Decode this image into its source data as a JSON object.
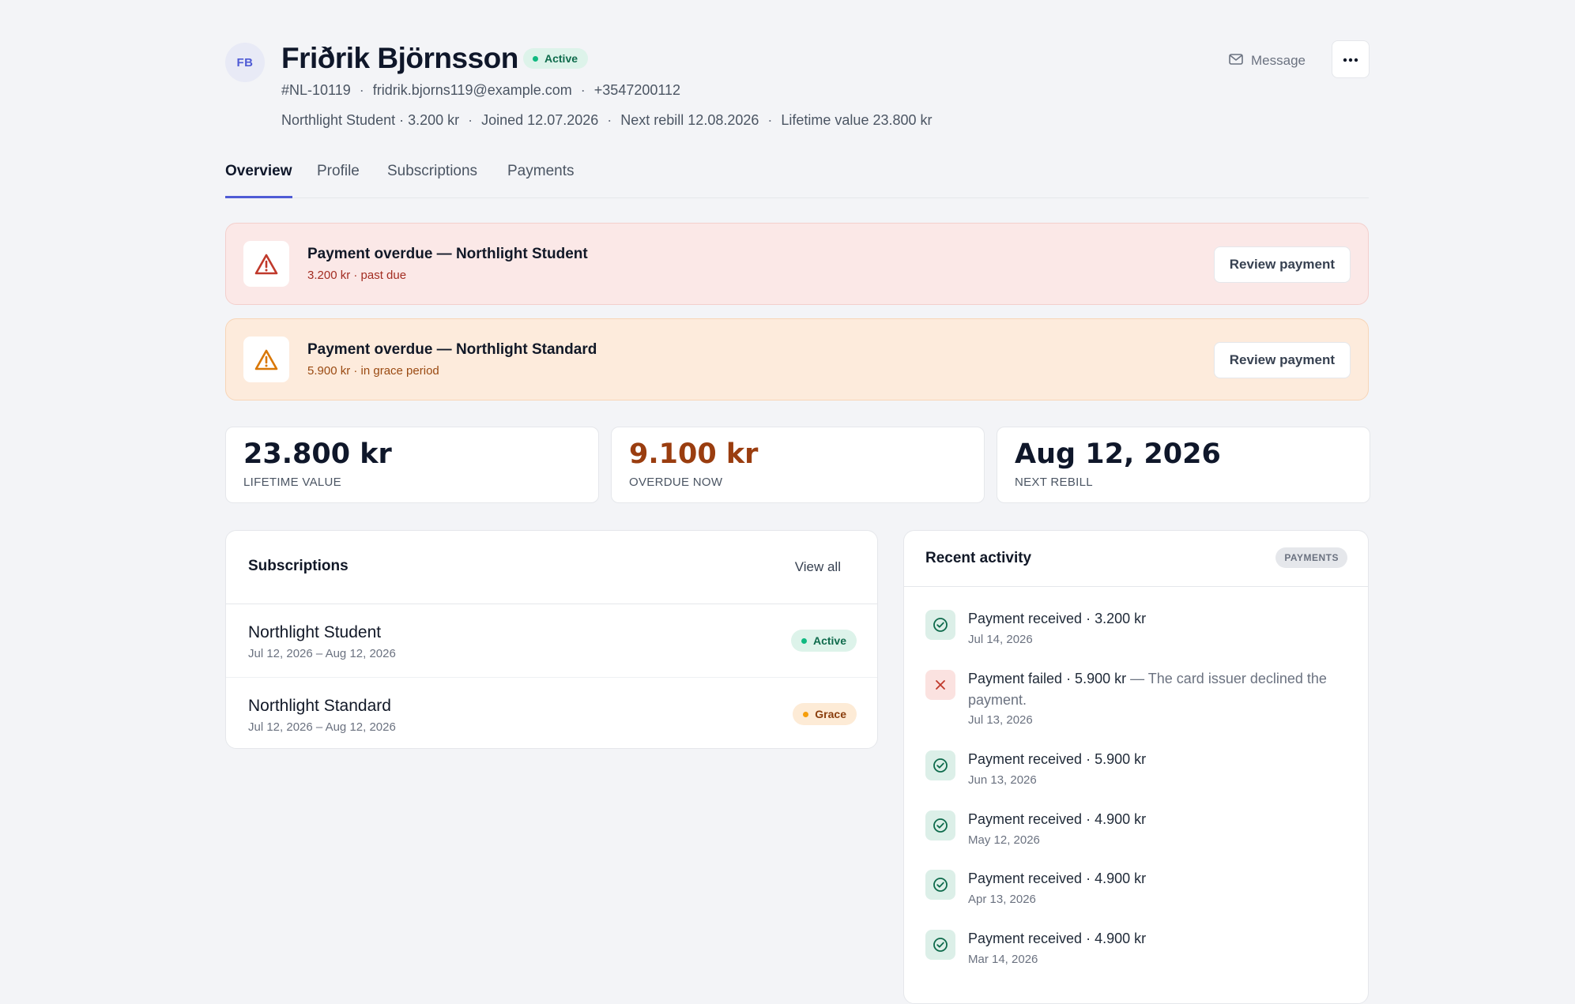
{
  "customer": {
    "initials": "FB",
    "name": "Friðrik Björnsson",
    "status": "Active",
    "id": "#NL-10119",
    "email": "fridrik.bjorns119@example.com",
    "phone": "+3547200112",
    "plan": "Northlight Student · 3.200 kr",
    "joined": "Joined 12.07.2026",
    "next_rebill": "Next rebill 12.08.2026",
    "lifetime_value": "Lifetime value 23.800 kr",
    "separator": "·"
  },
  "actions": {
    "message_label": "Message",
    "more_icon": "more-horizontal-icon"
  },
  "tabs": [
    {
      "label": "Overview",
      "active": true
    },
    {
      "label": "Profile"
    },
    {
      "label": "Subscriptions"
    },
    {
      "label": "Payments"
    }
  ],
  "alerts": [
    {
      "title": "Payment overdue — Northlight Student",
      "subtitle": "3.200 kr · past due",
      "button": "Review payment",
      "color": "#c0392b",
      "icon": "warning-triangle-icon"
    },
    {
      "title": "Payment overdue — Northlight Standard",
      "subtitle": "5.900 kr · in grace period",
      "button": "Review payment",
      "color": "#d97706",
      "icon": "warning-triangle-icon"
    }
  ],
  "stats": [
    {
      "value": "23.800 kr",
      "label": "LIFETIME VALUE"
    },
    {
      "value": "9.100 kr",
      "label": "OVERDUE NOW"
    },
    {
      "value": "Aug 12, 2026",
      "label": "NEXT REBILL"
    }
  ],
  "subscriptions": {
    "title": "Subscriptions",
    "view_all": "View all",
    "items": [
      {
        "name": "Northlight Student",
        "dates": "Jul 12, 2026 – Aug 12, 2026",
        "status": "Active"
      },
      {
        "name": "Northlight Standard",
        "dates": "Jul 12, 2026 – Aug 12, 2026",
        "status": "Grace"
      }
    ]
  },
  "activity": {
    "title": "Recent activity",
    "badge": "PAYMENTS",
    "items": [
      {
        "text": "Payment received · 3.200 kr",
        "reason": "",
        "date": "Jul 14, 2026",
        "type": "ok"
      },
      {
        "text": "Payment failed · 5.900 kr",
        "reason": " — The card issuer declined the payment.",
        "date": "Jul 13, 2026",
        "type": "fail"
      },
      {
        "text": "Payment received · 5.900 kr",
        "reason": "",
        "date": "Jun 13, 2026",
        "type": "ok"
      },
      {
        "text": "Payment received · 4.900 kr",
        "reason": "",
        "date": "May 12, 2026",
        "type": "ok"
      },
      {
        "text": "Payment received · 4.900 kr",
        "reason": "",
        "date": "Apr 13, 2026",
        "type": "ok"
      },
      {
        "text": "Payment received · 4.900 kr",
        "reason": "",
        "date": "Mar 14, 2026",
        "type": "ok"
      }
    ]
  },
  "colors": {
    "accent": "#4f5bd5",
    "success": "#0f6b4c",
    "overdue": "#9a3d0f",
    "danger": "#c0392b"
  }
}
